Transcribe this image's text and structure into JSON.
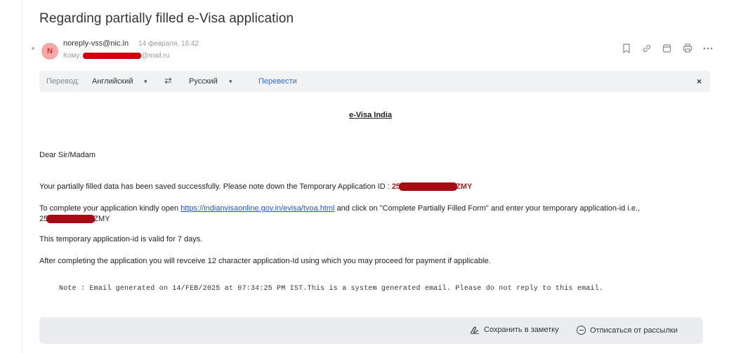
{
  "email": {
    "subject": "Regarding partially filled e-Visa application",
    "avatar_letter": "N",
    "sender": "noreply-vss@nic.in",
    "date": "14 февраля, 16:42",
    "to_label": "Кому:",
    "to_domain": "@mail.ru"
  },
  "actions": [
    "bookmark-icon",
    "link-icon",
    "calendar-icon",
    "print-icon",
    "more-icon"
  ],
  "translate": {
    "label": "Перевод:",
    "source_lang": "Английский",
    "target_lang": "Русский",
    "arrow": "▾",
    "swap": "⇄",
    "translate_button": "Перевести",
    "close": "×"
  },
  "body": {
    "heading": "e-Visa India",
    "greeting": "Dear Sir/Madam",
    "p1_text": "Your partially filled data has been saved successfully. Please note down the Temporary Application ID : ",
    "app_id_prefix": "25",
    "app_id_suffix": "ZMY",
    "p2_before": "To complete your application kindly open ",
    "p2_link": "https://indianvisaonline.gov.in/evisa/tvoa.html",
    "p2_after": " and click on \"Complete Partially Filled Form\" and enter your temporary application-id i.e.,",
    "p2_id_prefix": "25",
    "p2_id_suffix": "ZMY",
    "p3": "This temporary application-id is valid for 7 days.",
    "p4": "After completing the application you will revceive 12 character application-Id using which you may proceed for payment if applicable.",
    "note": "Note : Email generated on 14/FEB/2025 at 07:34:25 PM IST.This is a system generated email. Please do not reply to this email."
  },
  "footer": {
    "save_note": "Сохранить в заметку",
    "unsubscribe": "Отписаться от рассылки"
  }
}
